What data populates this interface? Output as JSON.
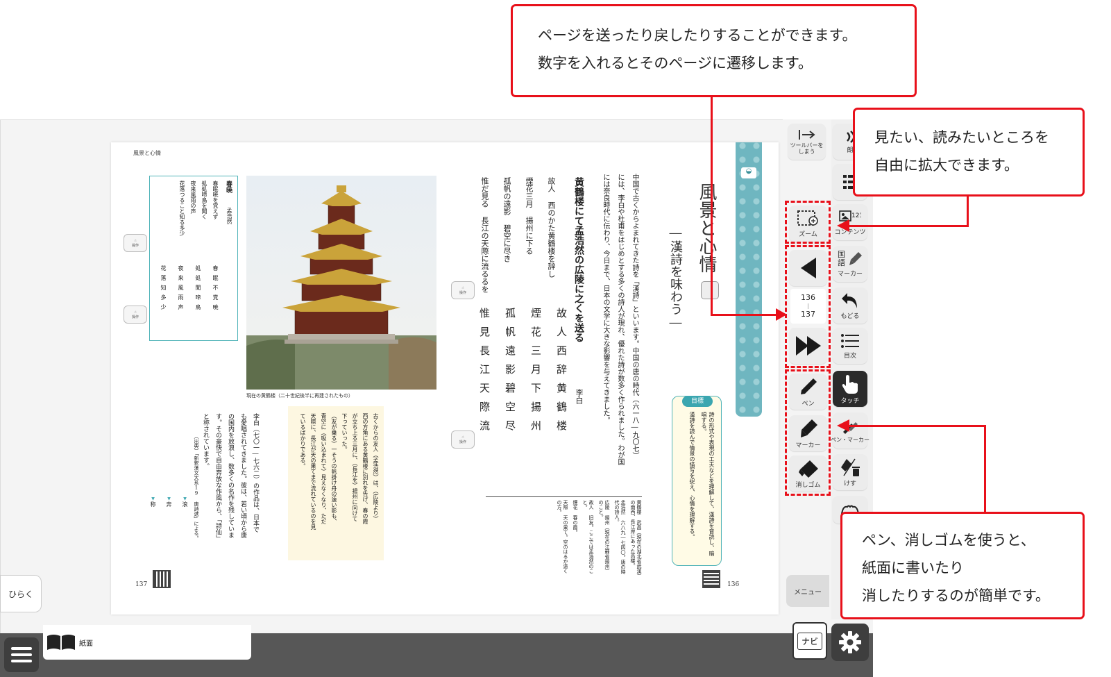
{
  "callouts": {
    "page_nav": [
      "ページを送ったり戻したりすることができます。",
      "数字を入れるとそのページに遷移します。"
    ],
    "zoom": [
      "見たい、読みたいところを",
      "自由に拡大できます。"
    ],
    "pen": [
      "ペン、消しゴムを使うと、",
      "紙面に書いたり",
      "消したりするのが簡単です。"
    ]
  },
  "toolbar": {
    "hide": "ツールバーをしまう",
    "zoom": "ズーム",
    "page_start": "136",
    "page_sep": "|",
    "page_end": "137",
    "pen": "ペン",
    "marker": "マーカー",
    "eraser": "消しゴム",
    "menu": "メニュー"
  },
  "right_toolbar": {
    "read": "朗",
    "contents": "コンテンツ",
    "subject": "国語",
    "subject_marker": "マーカー",
    "undo": "もどる",
    "toc": "目次",
    "touch": "タッチ",
    "pen_marker": "ペン・マーカー",
    "erase": "けす"
  },
  "bottom_bar": {
    "open": "ひらく",
    "mode_label": "紙面",
    "navi": "ナビ"
  },
  "left_page": {
    "header": "風景と心情",
    "page_number": "137",
    "poem_title": "春暁",
    "poem_author": "孟浩然",
    "poem_lines": [
      "春眠暁を覚えず",
      "処処啼鳥を聞く",
      "夜来風雨の声",
      "花落つること知る多少"
    ],
    "photo_caption": "現在の黄鶴楼（二十世紀後半に再建されたもの）",
    "note_lines": [
      "古くからの友人（孟浩然）は、（広陵より）",
      "西の方角にある黄鶴楼に別れを告げ、春の霞",
      "が立ち上る三月に、（長江を）揚州に向けて",
      "下っていった。",
      "（友が乗る）一そうの帆掛け舟の遠い影も、",
      "青空に（吸い込まれて）見えなくなり、ただ",
      "天際に、長江が天の果てまで流れているのを見",
      "ているばかりである。"
    ],
    "bio_lines": [
      "李白（七〇一―七六二）の作品は、日本で",
      "も愛唱されてきました。彼は、若い頃から唐",
      "の国内を放浪し、数多くの名作を残していま",
      "す。その豪快で自由奔放な作風から、「詩仙」",
      "と称されています。"
    ],
    "source": "（出典）「新釈漢文大系19 唐詩選」による。",
    "vocab": [
      "称",
      "奔",
      "浪"
    ],
    "action_label": "操作"
  },
  "right_page": {
    "page_number": "136",
    "unit_title": "風景と心情",
    "unit_subtitle": "―漢詩を味わう―",
    "intro_lines": [
      "中国で古くからよまれてきた詩を「漢詩」といいます。中国の唐の時代（六一八―九〇七）",
      "には、李白や杜甫をはじめとする多くの詩人が現れ、優れた詩が数多く作られました。わが国",
      "には奈良時代に伝わり、今日まで、日本の文学に大きな影響を与えてきました。"
    ],
    "poem_title": "黄鶴楼にて孟浩然の広陵に之くを送る",
    "poem_author": "李白",
    "kundoku_lines": [
      "故人 西のかた黄鶴楼を辞し",
      "煙花三月 揚州に下る",
      "孤帆の遠影 碧空に尽き",
      "惟だ見る 長江の天際に流るるを"
    ],
    "kanbun_lines": [
      "故人西辞黄鶴楼",
      "煙花三月下揚州",
      "孤帆遠影碧空尽",
      "惟見長江天際流"
    ],
    "goal_title": "目標",
    "goal_lines": [
      "詩の形式や表現の工夫などを理解して、漢詩を音読し、暗唱する。",
      "漢詩を読んで情景の描写を捉え、心情を理解する。"
    ],
    "glossary": [
      "黄鶴楼 武昌（現在の湖北省武漢）の南西、長江岸にあった高楼。",
      "孟浩然 六八九―七四〇。唐の時代の詩人。",
      "広陵 揚州（現在の江蘇省揚州）のこと。",
      "故人 旧友。ここでは孟浩然のこと。",
      "煙花 春の霞。",
      "天際 天の果て。空のはるか遠くの方。"
    ]
  }
}
